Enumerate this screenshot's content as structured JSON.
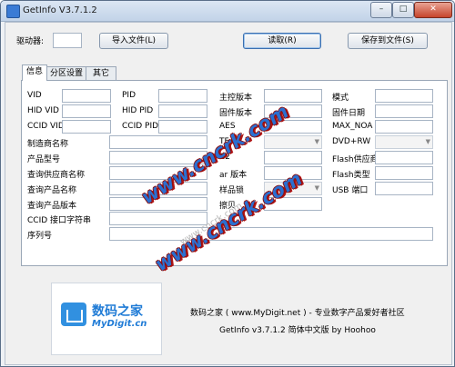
{
  "window": {
    "title": "GetInfo V3.7.1.2"
  },
  "toolbar": {
    "drive_label": "驱动器:",
    "import_btn": "导入文件(L)",
    "read_btn": "读取(R)",
    "save_btn": "保存到文件(S)"
  },
  "tabs": [
    {
      "label": "信息"
    },
    {
      "label": "分区设置"
    },
    {
      "label": "其它"
    }
  ],
  "col1": [
    {
      "label": "VID"
    },
    {
      "label": "HID VID"
    },
    {
      "label": "CCID VID"
    },
    {
      "label": "制造商名称"
    },
    {
      "label": "产品型号"
    },
    {
      "label": "查询供应商名称"
    },
    {
      "label": "查询产品名称"
    },
    {
      "label": "查询产品版本"
    },
    {
      "label": "CCID 接口字符串"
    },
    {
      "label": "序列号"
    }
  ],
  "col2": [
    {
      "label": "PID"
    },
    {
      "label": "HID PID"
    },
    {
      "label": "CCID PID"
    }
  ],
  "col3": [
    {
      "label": "主控版本"
    },
    {
      "label": "固件版本"
    },
    {
      "label": "AES"
    },
    {
      "label": "TF"
    },
    {
      "label": "C2"
    },
    {
      "label": "ar 版本"
    },
    {
      "label": "样品锁"
    },
    {
      "label": "擦贝"
    }
  ],
  "col4": [
    {
      "label": "模式"
    },
    {
      "label": "固件日期"
    },
    {
      "label": "MAX_NOA"
    },
    {
      "label": "DVD+RW"
    },
    {
      "label": "Flash供应商"
    },
    {
      "label": "Flash类型"
    },
    {
      "label": "USB 端口"
    }
  ],
  "footer": {
    "logo_cn": "数码之家",
    "logo_en": "MyDigit.cn",
    "line1": "数码之家 ( www.MyDigit.net ) - 专业数字产品爱好者社区",
    "line2": "GetInfo v3.7.1.2 简体中文版 by Hoohoo"
  },
  "watermarks": [
    "www.cncrk.com",
    "www.cncrk.com",
    "www.cncrk.com"
  ]
}
